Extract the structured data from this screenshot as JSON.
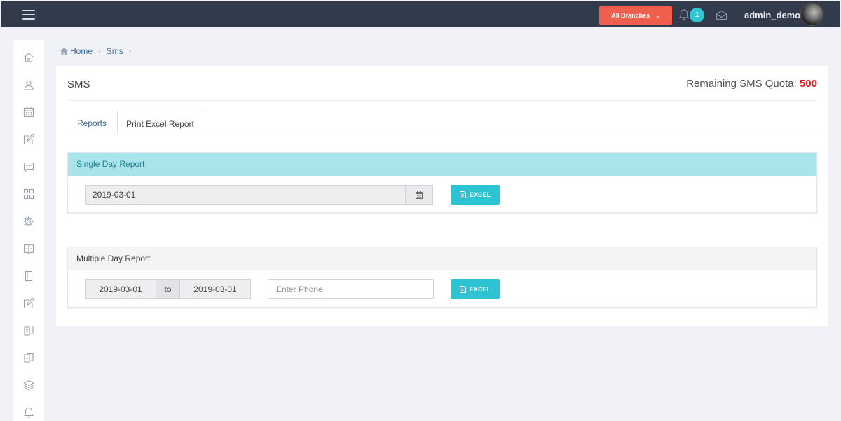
{
  "header": {
    "menu_icon": "hamburger-icon",
    "branch_button_label": "All Branches",
    "notification_count": "1",
    "username": "admin_demo"
  },
  "sidebar": {
    "icons": [
      "home-icon",
      "users-icon",
      "calendar-icon",
      "edit-icon",
      "message-icon",
      "grid-icon",
      "gear-icon",
      "book-icon",
      "door-icon",
      "edit-alt-icon",
      "clipboard-icon",
      "clipboard-alt-icon",
      "layers-icon",
      "bell-icon"
    ]
  },
  "breadcrumb": {
    "items": [
      "Home",
      "Sms"
    ]
  },
  "page": {
    "title": "SMS",
    "quota_label": "Remaining SMS Quota:",
    "quota_value": "500"
  },
  "tabs": [
    {
      "label": "Reports"
    },
    {
      "label": "Print Excel Report"
    }
  ],
  "single_day": {
    "heading": "Single Day Report",
    "date_value": "2019-03-01",
    "button_label": "EXCEL"
  },
  "multiple_day": {
    "heading": "Multiple Day Report",
    "from_date": "2019-03-01",
    "to_label": "to",
    "to_date": "2019-03-01",
    "phone_placeholder": "Enter Phone",
    "button_label": "EXCEL"
  },
  "colors": {
    "topbar": "#323b4c",
    "branch_button": "#f05f4e",
    "accent": "#2cc4d3",
    "quota_value": "#e21b1b",
    "single_day_header": "#a8e4ea"
  }
}
